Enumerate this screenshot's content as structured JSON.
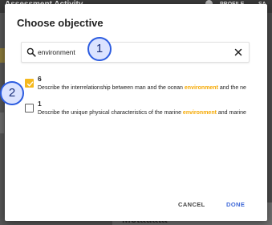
{
  "background": {
    "app_title": "Assessment Activity",
    "user_label": "PROFILE",
    "user_suffix": "SA",
    "section_label": "Metadata"
  },
  "dialog": {
    "title": "Choose objective",
    "search": {
      "value": "environment",
      "placeholder": ""
    },
    "items": [
      {
        "number": "6",
        "text_before": "Describe the interrelationship between man and the ocean ",
        "highlight": "environment",
        "text_after": " and the ne",
        "checked": true
      },
      {
        "number": "1",
        "text_before": "Describe the unique physical characteristics of the marine ",
        "highlight": "environment",
        "text_after": " and marine",
        "checked": false
      }
    ],
    "cancel_label": "CANCEL",
    "done_label": "DONE"
  },
  "callouts": [
    "1",
    "2"
  ],
  "colors": {
    "accent": "#f5b81c",
    "highlight": "#f5a800",
    "primary_button": "#3f68d8",
    "callout_border": "#2c5ce0",
    "callout_fill": "#dbe3ff"
  },
  "icons": {
    "search": "search-icon",
    "clear": "close-icon",
    "check": "check-icon"
  }
}
